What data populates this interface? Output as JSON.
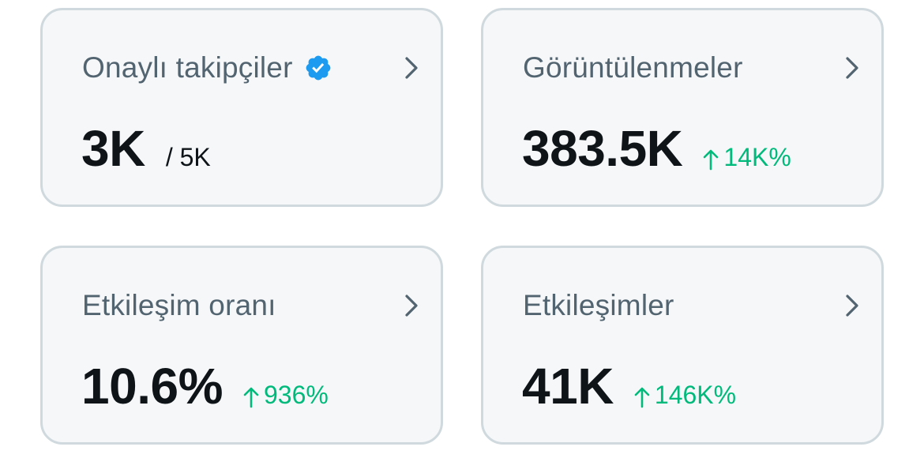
{
  "cards": [
    {
      "title": "Onaylı takipçiler",
      "value": "3K",
      "sub": "/ 5K",
      "verified": true
    },
    {
      "title": "Görüntülenmeler",
      "value": "383.5K",
      "change": "14K%",
      "trend": "up"
    },
    {
      "title": "Etkileşim oranı",
      "value": "10.6%",
      "change": "936%",
      "trend": "up"
    },
    {
      "title": "Etkileşimler",
      "value": "41K",
      "change": "146K%",
      "trend": "up"
    }
  ],
  "colors": {
    "card_bg": "#f5f7f8",
    "card_border": "#cfd9de",
    "title": "#536471",
    "value": "#0f1419",
    "positive": "#00ba7c",
    "verified": "#1d9bf0",
    "chevron": "#536471"
  }
}
